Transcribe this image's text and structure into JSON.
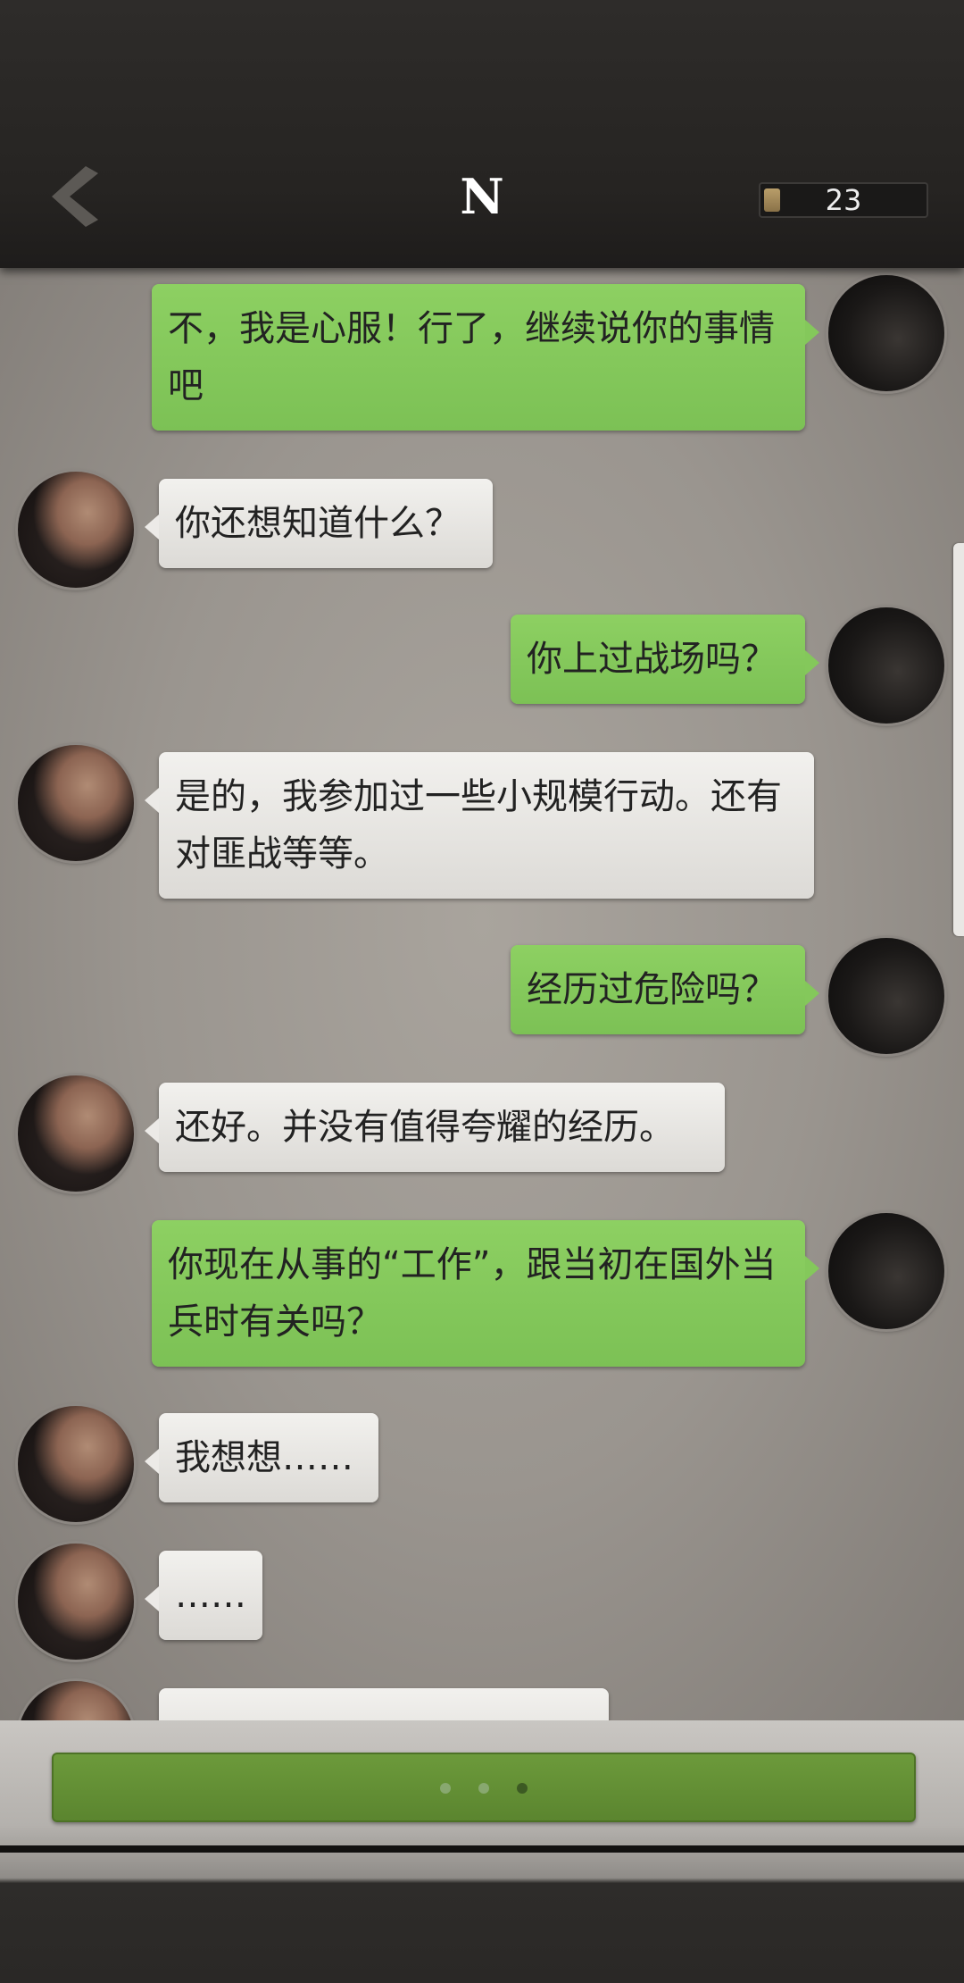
{
  "header": {
    "title": "N",
    "counter": "23",
    "counter_fill_fraction": 0.1
  },
  "messages": [
    {
      "from": "me",
      "text": "不，我是心服！行了，继续说你的事情吧"
    },
    {
      "from": "him",
      "text": "你还想知道什么？"
    },
    {
      "from": "me",
      "text": "你上过战场吗？"
    },
    {
      "from": "him",
      "text": "是的，我参加过一些小规模行动。还有对匪战等等。"
    },
    {
      "from": "me",
      "text": "经历过危险吗？"
    },
    {
      "from": "him",
      "text": "还好。并没有值得夸耀的经历。"
    },
    {
      "from": "me",
      "text": "你现在从事的“工作”，跟当初在国外当兵时有关吗？"
    },
    {
      "from": "him",
      "text": "我想想……"
    },
    {
      "from": "him",
      "text": "……"
    },
    {
      "from": "him",
      "text": ""
    }
  ],
  "bottom": {
    "dots": 3,
    "active_dot": 2
  }
}
